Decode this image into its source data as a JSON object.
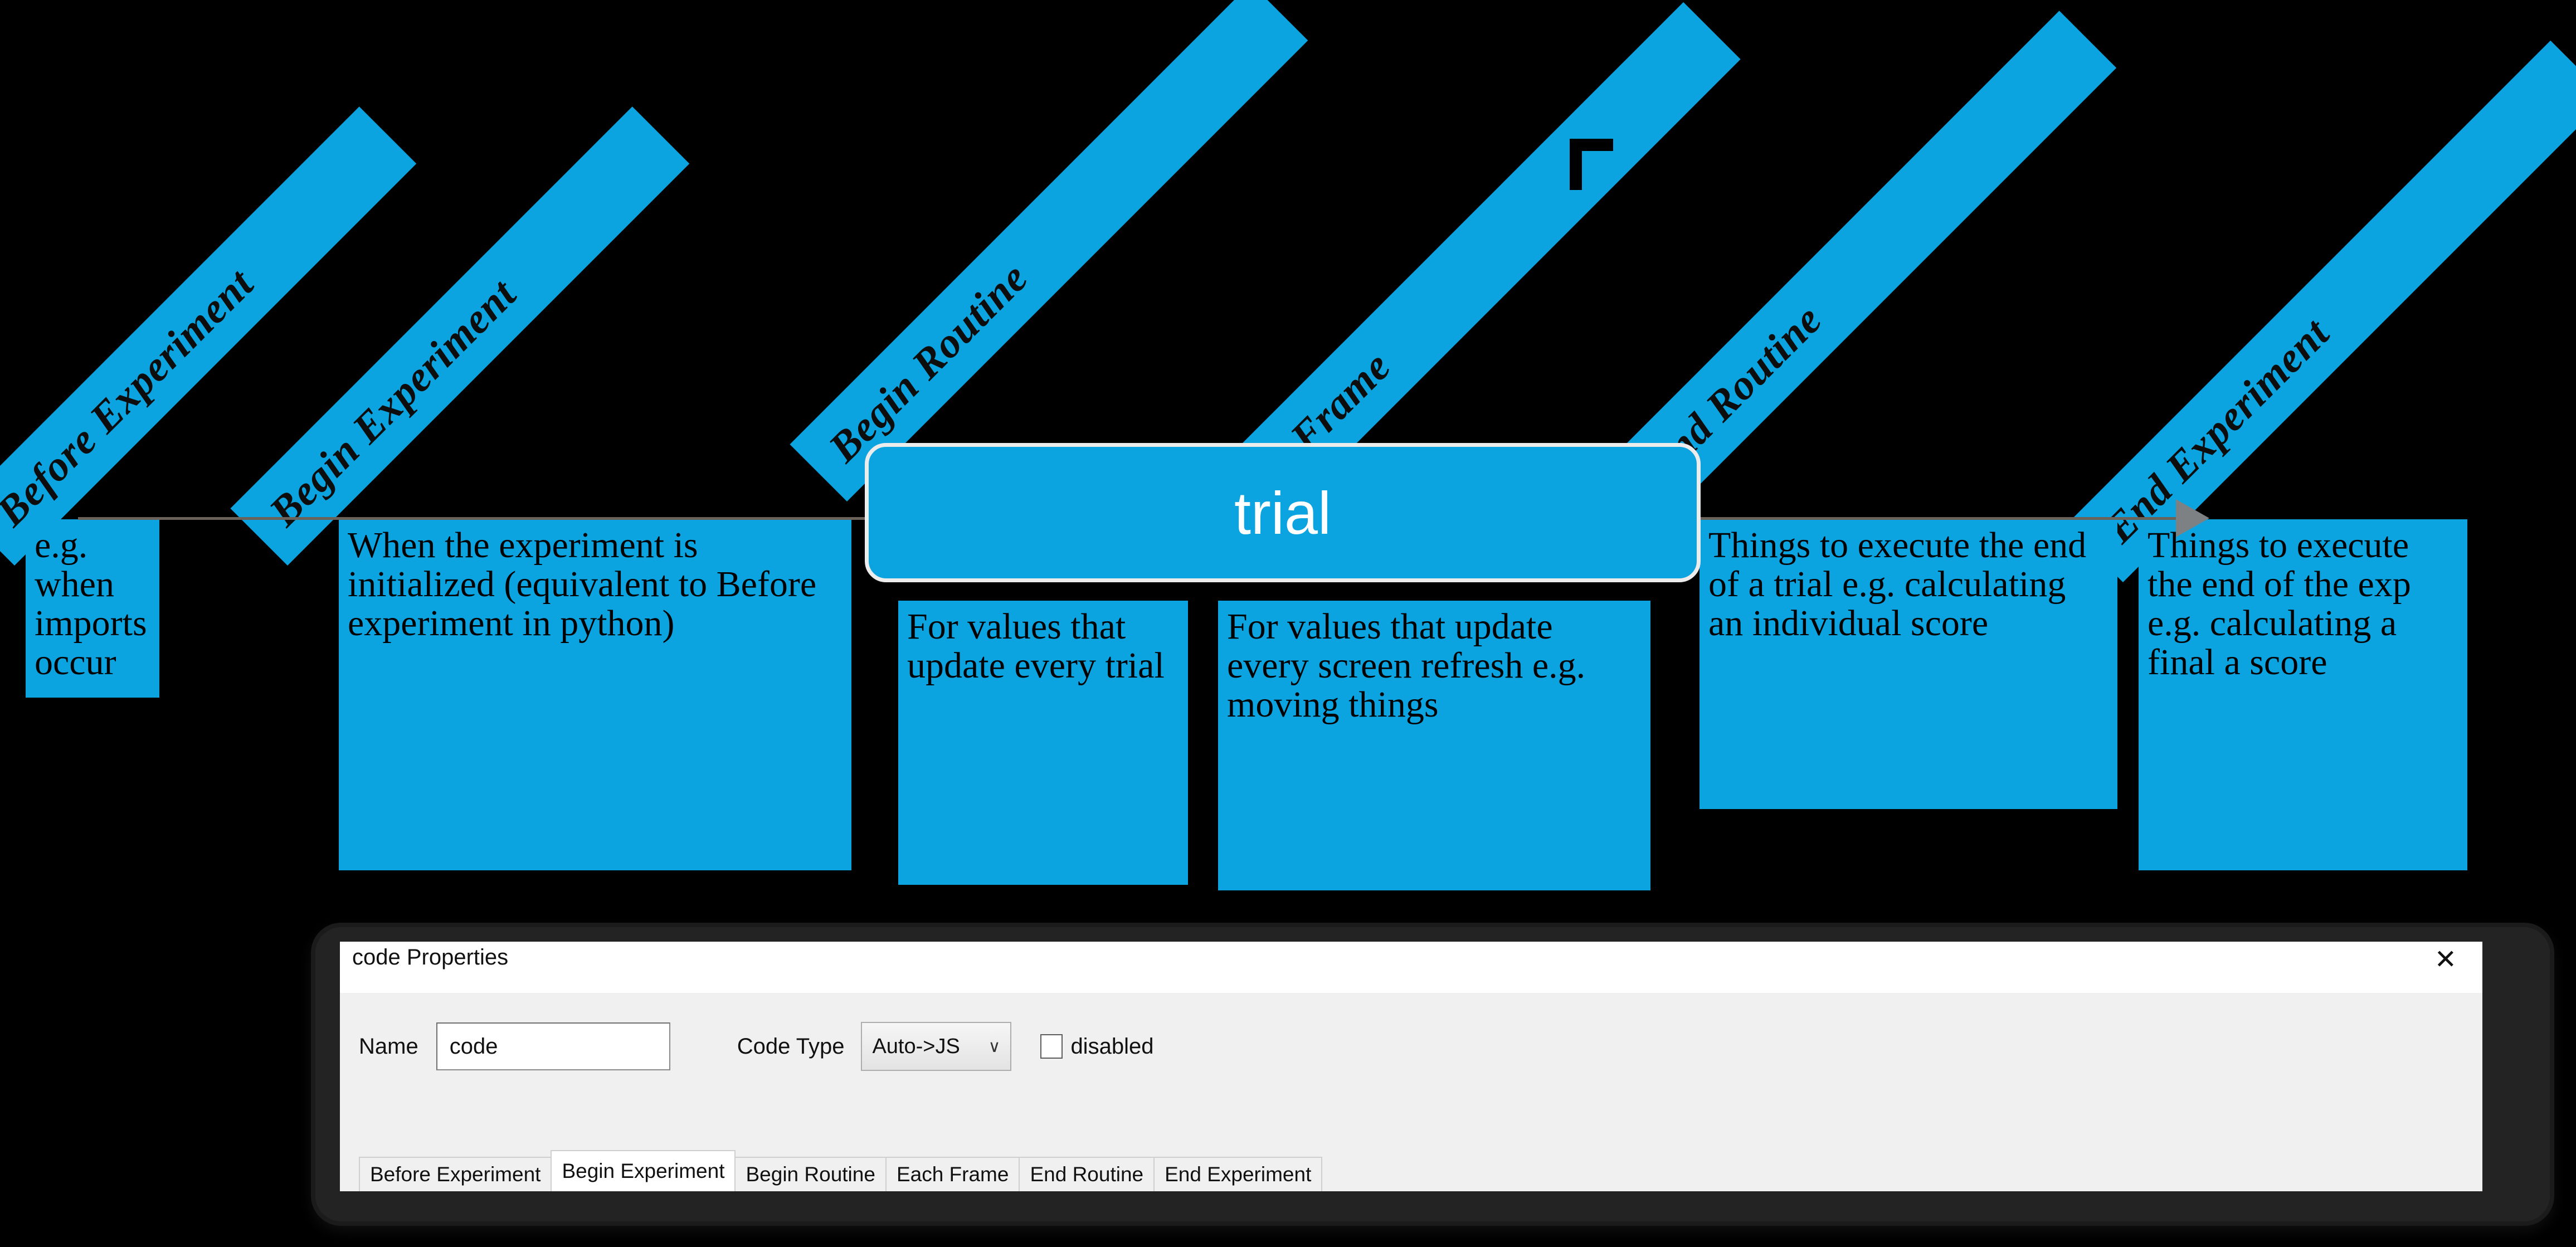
{
  "diagram": {
    "center_node": {
      "label": "trial"
    },
    "phases": [
      {
        "ribbon": "Before Experiment",
        "description": "e.g. when imports occur"
      },
      {
        "ribbon": "Begin Experiment",
        "description": "When the experiment is initialized (equivalent to Before experiment in python)"
      },
      {
        "ribbon": "Begin Routine",
        "description": "For values that update every trial"
      },
      {
        "ribbon": "Each Frame",
        "description": "For values that update every screen refresh e.g. moving things"
      },
      {
        "ribbon": "End Routine",
        "description": "Things to execute the end of a trial e.g. calculating an individual score"
      },
      {
        "ribbon": "End Experiment",
        "description": "Things to execute the end of the exp e.g. calculating a final a score"
      }
    ],
    "colors": {
      "accent": "#0BA4E0",
      "background": "#000000",
      "connector": "#6b6259",
      "arrow": "#7e8184"
    }
  },
  "dialog": {
    "title": "code Properties",
    "close_label": "✕",
    "name_label": "Name",
    "name_value": "code",
    "name_placeholder": "code",
    "code_type_label": "Code Type",
    "code_type_value": "Auto->JS",
    "code_type_chevron": "∨",
    "disabled_label": "disabled",
    "tabs": [
      {
        "label": "Before Experiment",
        "active": false
      },
      {
        "label": "Begin Experiment",
        "active": true
      },
      {
        "label": "Begin Routine",
        "active": false
      },
      {
        "label": "Each Frame",
        "active": false
      },
      {
        "label": "End Routine",
        "active": false
      },
      {
        "label": "End Experiment",
        "active": false
      }
    ]
  }
}
